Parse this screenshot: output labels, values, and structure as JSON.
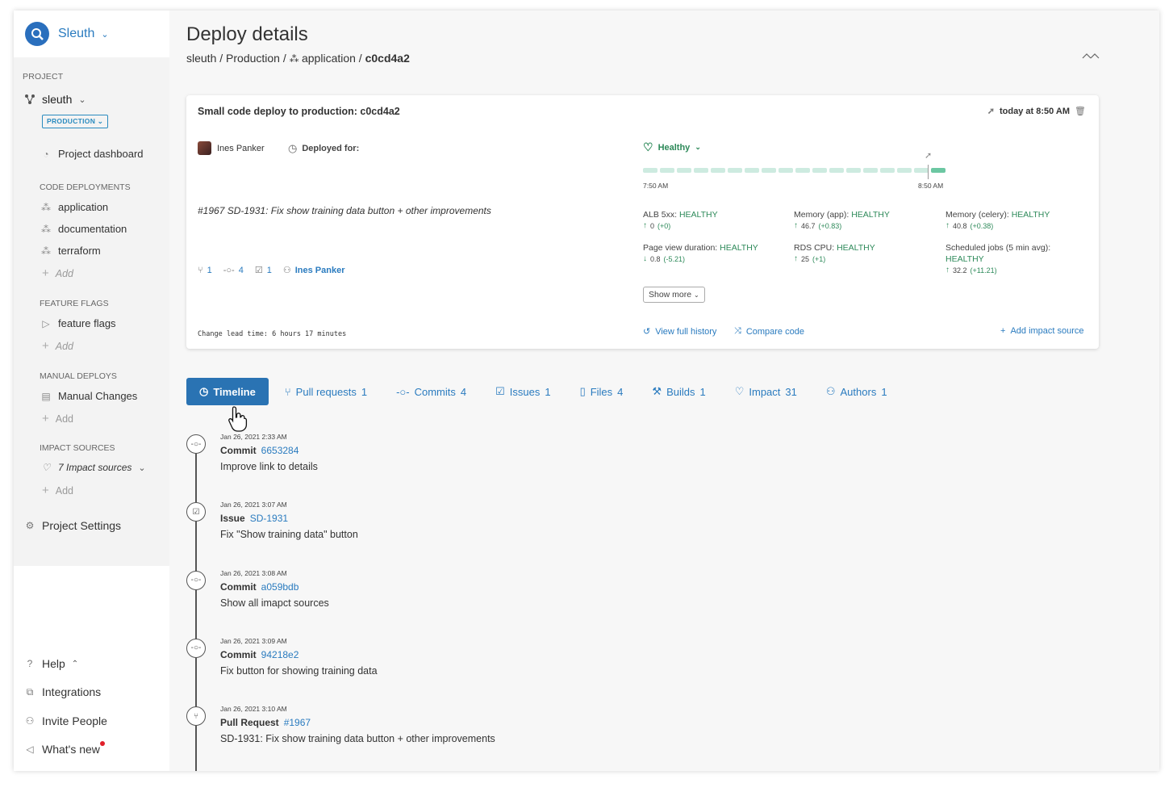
{
  "brand": {
    "name": "Sleuth"
  },
  "sidebar": {
    "project_label": "PROJECT",
    "project_name": "sleuth",
    "environment": "PRODUCTION",
    "dashboard": "Project dashboard",
    "code_deployments_label": "CODE DEPLOYMENTS",
    "code_deployments": [
      "application",
      "documentation",
      "terraform"
    ],
    "add_label": "Add",
    "feature_flags_label": "FEATURE FLAGS",
    "feature_flags": "feature flags",
    "manual_deploys_label": "MANUAL DEPLOYS",
    "manual_changes": "Manual Changes",
    "impact_sources_label": "IMPACT SOURCES",
    "impact_sources": "7 Impact sources",
    "settings": "Project Settings",
    "help": "Help",
    "integrations": "Integrations",
    "invite": "Invite People",
    "whats_new": "What's new"
  },
  "header": {
    "title": "Deploy details",
    "crumb_1": "sleuth / Production / ",
    "crumb_2": "application / ",
    "crumb_3": "c0cd4a2"
  },
  "deploy": {
    "title": "Small code deploy to production: c0cd4a2",
    "time": "today at 8:50 AM",
    "author": "Ines Panker",
    "deployed_for": "Deployed for:",
    "message": "#1967 SD-1931: Fix show training data button + other improvements",
    "pull_requests": "1",
    "commits": "4",
    "issues": "1",
    "lead_time": "Change lead time: 6 hours 17 minutes",
    "health": "Healthy",
    "bars_count": 18,
    "tick_start": "7:50 AM",
    "tick_end": "8:50 AM",
    "metrics": [
      {
        "name": "ALB 5xx: ",
        "status": "HEALTHY",
        "value": "0",
        "delta": "(+0)",
        "dir": "up"
      },
      {
        "name": "Memory (app): ",
        "status": "HEALTHY",
        "value": "46.7",
        "delta": "(+0.83)",
        "dir": "up"
      },
      {
        "name": "Memory (celery): ",
        "status": "HEALTHY",
        "value": "40.8",
        "delta": "(+0.38)",
        "dir": "up"
      },
      {
        "name": "Page view duration: ",
        "status": "HEALTHY",
        "value": "0.8",
        "delta": "(-5.21)",
        "dir": "down"
      },
      {
        "name": "RDS CPU: ",
        "status": "HEALTHY",
        "value": "25",
        "delta": "(+1)",
        "dir": "up"
      },
      {
        "name": "Scheduled jobs (5 min avg): ",
        "status": "HEALTHY",
        "value": "32.2",
        "delta": "(+11.21)",
        "dir": "up"
      }
    ],
    "show_more": "Show more",
    "view_history": "View full history",
    "compare_code": "Compare code",
    "add_impact": "Add impact source"
  },
  "tabs": [
    {
      "label": "Timeline",
      "count": ""
    },
    {
      "label": "Pull requests",
      "count": "1"
    },
    {
      "label": "Commits",
      "count": "4"
    },
    {
      "label": "Issues",
      "count": "1"
    },
    {
      "label": "Files",
      "count": "4"
    },
    {
      "label": "Builds",
      "count": "1"
    },
    {
      "label": "Impact",
      "count": "31"
    },
    {
      "label": "Authors",
      "count": "1"
    }
  ],
  "timeline": [
    {
      "date": "Jan 26, 2021 2:33 AM",
      "kind": "Commit",
      "ref": "6653284",
      "text": "Improve link to details",
      "icon": "commit-icon"
    },
    {
      "date": "Jan 26, 2021 3:07 AM",
      "kind": "Issue",
      "ref": "SD-1931",
      "text": "Fix \"Show training data\" button",
      "icon": "issue-icon"
    },
    {
      "date": "Jan 26, 2021 3:08 AM",
      "kind": "Commit",
      "ref": "a059bdb",
      "text": "Show all imapct sources",
      "icon": "commit-icon"
    },
    {
      "date": "Jan 26, 2021 3:09 AM",
      "kind": "Commit",
      "ref": "94218e2",
      "text": "Fix button for showing training data",
      "icon": "commit-icon"
    },
    {
      "date": "Jan 26, 2021 3:10 AM",
      "kind": "Pull Request",
      "ref": "#1967",
      "text": "SD-1931: Fix show training data button + other improvements",
      "icon": "pull-request-icon"
    }
  ],
  "colors": {
    "accent": "#2a73b3",
    "healthy": "#2e8a5a",
    "link": "#2a7bbf"
  }
}
